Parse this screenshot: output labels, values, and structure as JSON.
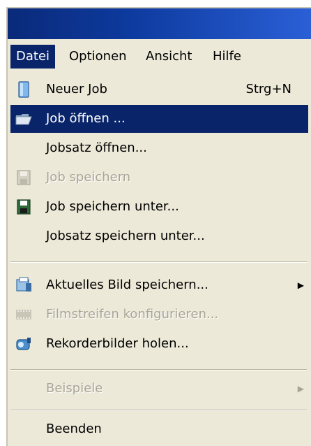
{
  "menubar": {
    "items": [
      {
        "label": "Datei",
        "active": true
      },
      {
        "label": "Optionen"
      },
      {
        "label": "Ansicht"
      },
      {
        "label": "Hilfe"
      }
    ]
  },
  "menu": {
    "items": [
      {
        "label": "Neuer Job",
        "shortcut": "Strg+N",
        "icon": "new-document-icon"
      },
      {
        "label": "Job öffnen ...",
        "icon": "open-folder-icon",
        "highlighted": true
      },
      {
        "label": "Jobsatz öffnen..."
      },
      {
        "label": "Job speichern",
        "icon": "save-disk-icon",
        "disabled": true
      },
      {
        "label": "Job speichern unter...",
        "icon": "save-as-disk-icon"
      },
      {
        "label": "Jobsatz speichern unter..."
      },
      {
        "label": "Aktuelles Bild speichern...",
        "icon": "save-image-icon",
        "submenu": true
      },
      {
        "label": "Filmstreifen konfigurieren...",
        "icon": "filmstrip-icon",
        "disabled": true
      },
      {
        "label": "Rekorderbilder holen...",
        "icon": "recorder-icon"
      },
      {
        "label": "Beispiele",
        "disabled": true,
        "submenu": true
      },
      {
        "label": "Beenden"
      }
    ]
  },
  "colors": {
    "highlight": "#0a246a",
    "menu_bg": "#ece9d8",
    "disabled_text": "#a8a596"
  }
}
